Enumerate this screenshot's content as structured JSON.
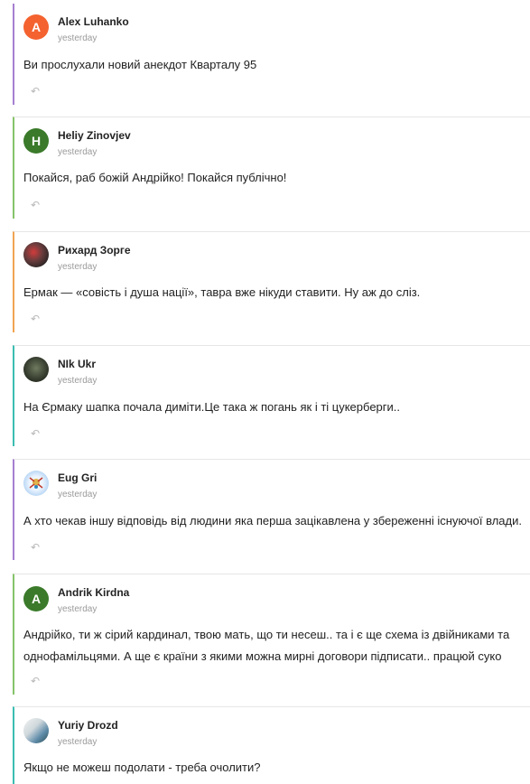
{
  "colors": {
    "purple": "#a77fd1",
    "green": "#86c46a",
    "orange": "#f0a453",
    "teal": "#3bbdb1",
    "avatar_orange": "#f4622f",
    "avatar_green": "#3a7a2a"
  },
  "comments": [
    {
      "author": "Alex Luhanko",
      "time": "yesterday",
      "text": "Ви прослухали новий анекдот Кварталу 95",
      "avatar_letter": "A",
      "avatar_kind": "letter",
      "reply_icon": "reply-icon"
    },
    {
      "author": "Heliy Zinovjev",
      "time": "yesterday",
      "text": "Покайся, раб божій Андрійко! Покайся публічно!",
      "avatar_letter": "H",
      "avatar_kind": "letter",
      "reply_icon": "reply-icon"
    },
    {
      "author": "Рихард Зорге",
      "time": "yesterday",
      "text": "Ермак — «совість і душа нації», тавра вже нікуди ставити. Ну аж до сліз.",
      "avatar_letter": "",
      "avatar_kind": "photo",
      "reply_icon": "reply-icon"
    },
    {
      "author": "NIk Ukr",
      "time": "yesterday",
      "text": "На Єрмаку шапка почала диміти.Це така ж погань як і ті цукерберги..",
      "avatar_letter": "",
      "avatar_kind": "photo",
      "reply_icon": "reply-icon"
    },
    {
      "author": "Eug Gri",
      "time": "yesterday",
      "text": "А хто чекав іншу відповідь від людини яка перша зацікавлена у збереженні існуючої влади.",
      "avatar_letter": "",
      "avatar_kind": "photo",
      "reply_icon": "reply-icon"
    },
    {
      "author": "Andrik Kirdna",
      "time": "yesterday",
      "text": "Андрійко, ти ж сірий кардинал, твою мать, що ти несеш.. та і є ще схема із двійниками та однофамільцями. А ще є країни з якими можна мирні договори підписати.. працюй суко",
      "avatar_letter": "A",
      "avatar_kind": "letter",
      "reply_icon": "reply-icon"
    },
    {
      "author": "Yuriy Drozd",
      "time": "yesterday",
      "text": "Якщо не можеш подолати - треба очолити?",
      "avatar_letter": "",
      "avatar_kind": "photo",
      "reply_icon": "reply-icon"
    }
  ]
}
